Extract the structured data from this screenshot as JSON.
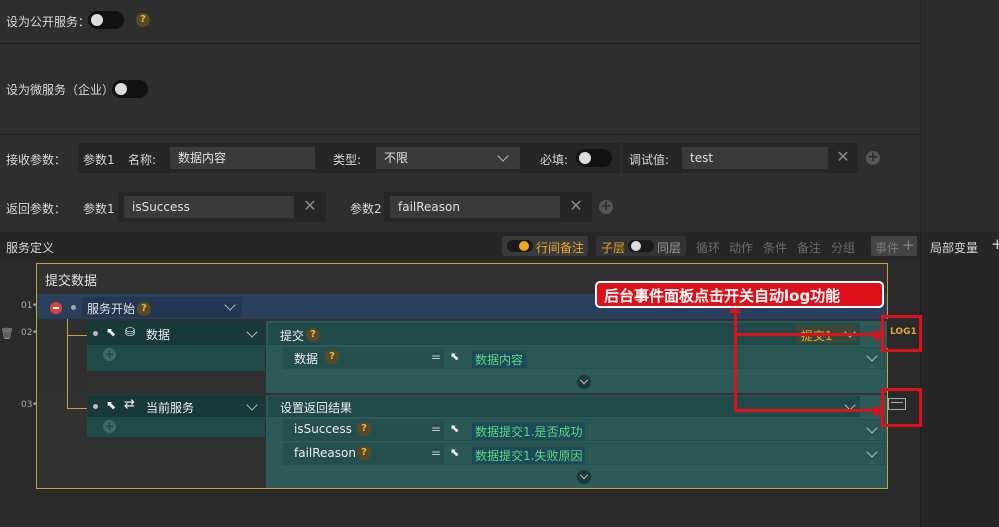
{
  "public_service": {
    "label": "设为公开服务：",
    "help": "?"
  },
  "micro_service": {
    "label": "设为微服务（企业）"
  },
  "receive_params": {
    "label": "接收参数：",
    "param_label": "参数1",
    "name_label": "名称:",
    "name_value": "数据内容",
    "type_label": "类型:",
    "type_value": "不限",
    "required_label": "必填:",
    "debug_label": "调试值:",
    "debug_value": "test"
  },
  "return_params": {
    "label": "返回参数：",
    "param1_label": "参数1",
    "param1_value": "isSuccess",
    "param2_label": "参数2",
    "param2_value": "failReason"
  },
  "service_def": {
    "title": "服务定义",
    "toolbar": {
      "inline_note": "行间备注",
      "child_layer": "子层",
      "same_layer": "同层",
      "loop": "循环",
      "action": "动作",
      "condition": "条件",
      "note": "备注",
      "group": "分组",
      "event": "事件"
    },
    "local_vars": "局部变量"
  },
  "flow": {
    "block_title": "提交数据",
    "rows": [
      {
        "num": "01",
        "label": "服务开始",
        "help": "?"
      },
      {
        "num": "02",
        "label": "数据",
        "action": "提交",
        "help": "?",
        "action_value": "提交1",
        "sub_label": "数据",
        "sub_value": "数据内容"
      },
      {
        "num": "03",
        "label": "当前服务",
        "action": "设置返回结果",
        "sub1_label": "isSuccess",
        "sub1_value": "数据提交1.是否成功",
        "sub2_label": "failReason",
        "sub2_value": "数据提交1.失败原因"
      }
    ]
  },
  "annotation": {
    "text": "后台事件面板点击开关自动log功能",
    "log_badge": "LOG1",
    "color": "#e0101a"
  },
  "colors": {
    "accent": "#e9a920",
    "teal_dark": "#1f4a47",
    "teal": "#2c5a58",
    "flow_blue": "#2a3f5c",
    "value_green": "#5cd87a"
  }
}
